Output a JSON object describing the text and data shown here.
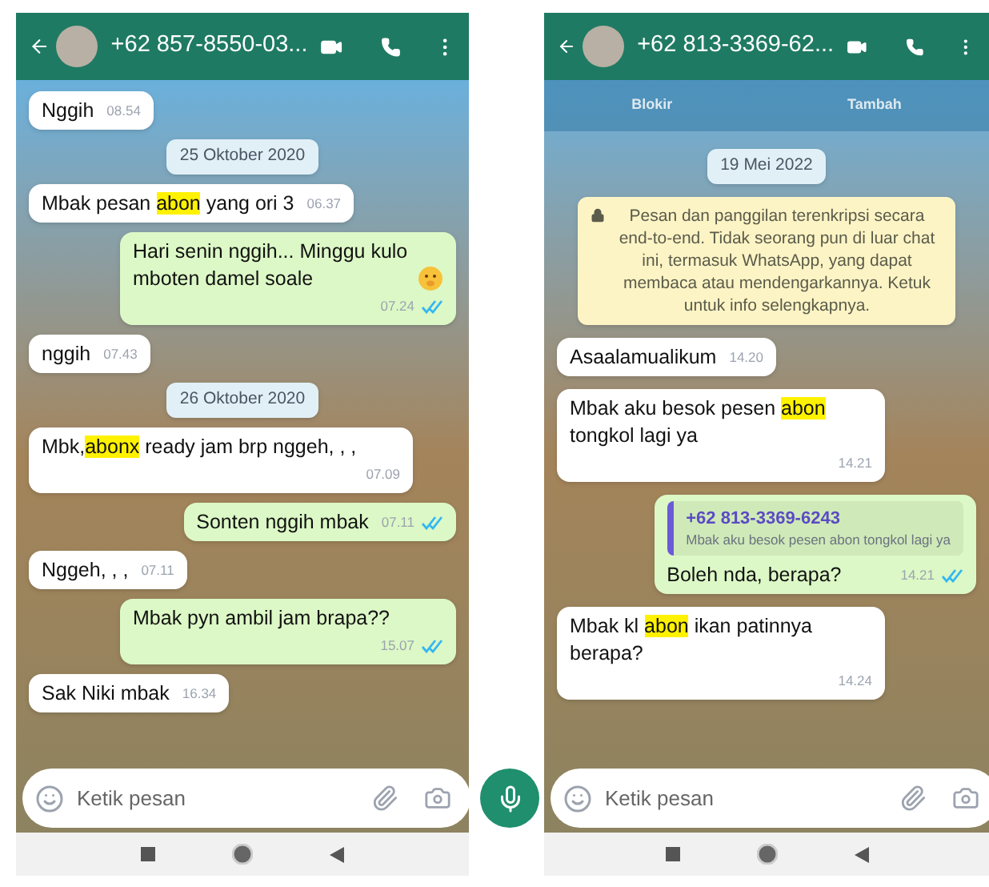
{
  "phones": [
    {
      "title": "+62 857-8550-03...",
      "input": {
        "placeholder": "Ketik pesan"
      },
      "messages": [
        {
          "kind": "in",
          "parts": [
            {
              "text": "Nggih",
              "highlight": false
            }
          ],
          "time": "08.54"
        },
        {
          "kind": "date",
          "text": "25 Oktober 2020"
        },
        {
          "kind": "in",
          "parts": [
            {
              "text": "Mbak pesan ",
              "highlight": false
            },
            {
              "text": "abon",
              "highlight": true
            },
            {
              "text": " yang ori 3",
              "highlight": false
            }
          ],
          "time": "06.37"
        },
        {
          "kind": "out",
          "parts": [
            {
              "text": "Hari senin nggih... Minggu kulo mboten damel soale",
              "highlight": false
            }
          ],
          "emoji": true,
          "time": "07.24",
          "read": true
        },
        {
          "kind": "in",
          "parts": [
            {
              "text": "nggih",
              "highlight": false
            }
          ],
          "time": "07.43"
        },
        {
          "kind": "date",
          "text": "26 Oktober 2020"
        },
        {
          "kind": "in",
          "parts": [
            {
              "text": "Mbk,",
              "highlight": false
            },
            {
              "text": "abonx",
              "highlight": true
            },
            {
              "text": " ready jam brp nggeh, , ,",
              "highlight": false
            }
          ],
          "time": "07.09"
        },
        {
          "kind": "out",
          "parts": [
            {
              "text": "Sonten nggih mbak",
              "highlight": false
            }
          ],
          "time": "07.11",
          "read": true
        },
        {
          "kind": "in",
          "parts": [
            {
              "text": "Nggeh, , ,",
              "highlight": false
            }
          ],
          "time": "07.11"
        },
        {
          "kind": "out",
          "parts": [
            {
              "text": "Mbak pyn ambil jam brapa??",
              "highlight": false
            }
          ],
          "time": "15.07",
          "read": true
        },
        {
          "kind": "in",
          "parts": [
            {
              "text": "Sak Niki mbak",
              "highlight": false
            }
          ],
          "time": "16.34"
        }
      ]
    },
    {
      "title": "+62 813-3369-62...",
      "actions": [
        "Blokir",
        "Tambah"
      ],
      "input": {
        "placeholder": "Ketik pesan"
      },
      "messages": [
        {
          "kind": "date",
          "text": "19 Mei 2022"
        },
        {
          "kind": "system",
          "text": "Pesan dan panggilan terenkripsi secara end-to-end. Tidak seorang pun di luar chat ini, termasuk WhatsApp, yang dapat membaca atau mendengarkannya. Ketuk untuk info selengkapnya."
        },
        {
          "kind": "in",
          "parts": [
            {
              "text": "Asaalamualikum",
              "highlight": false
            }
          ],
          "time": "14.20"
        },
        {
          "kind": "in",
          "parts": [
            {
              "text": "Mbak aku besok pesen ",
              "highlight": false
            },
            {
              "text": "abon",
              "highlight": true
            },
            {
              "text": " tongkol lagi ya",
              "highlight": false
            }
          ],
          "time": "14.21"
        },
        {
          "kind": "out",
          "quote": {
            "author": "+62 813-3369-6243",
            "text": "Mbak aku besok pesen abon tongkol lagi ya"
          },
          "parts": [
            {
              "text": "Boleh nda, berapa?",
              "highlight": false
            }
          ],
          "time": "14.21",
          "read": true
        },
        {
          "kind": "in",
          "parts": [
            {
              "text": "Mbak kl ",
              "highlight": false
            },
            {
              "text": "abon",
              "highlight": true
            },
            {
              "text": " ikan patinnya berapa?",
              "highlight": false
            }
          ],
          "time": "14.24"
        }
      ]
    }
  ]
}
